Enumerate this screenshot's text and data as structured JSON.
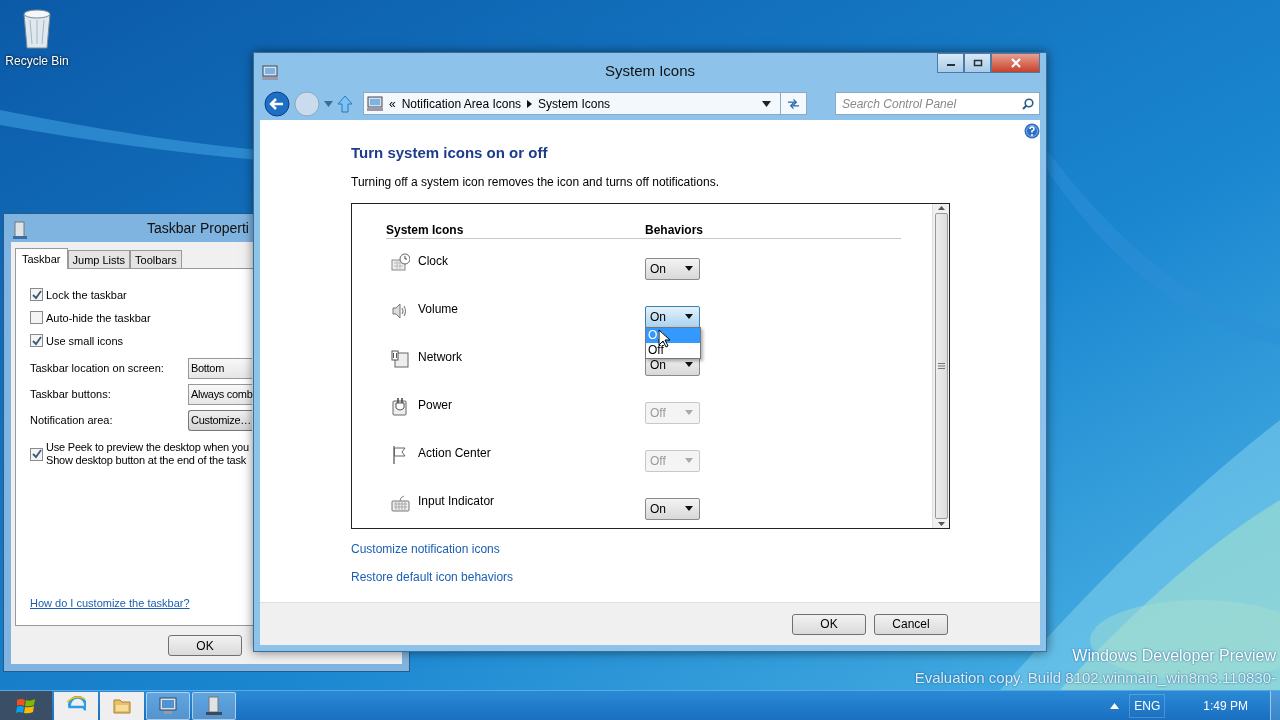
{
  "desktop": {
    "icons": [
      {
        "label": "Recycle Bin"
      }
    ],
    "watermark": [
      "Windows Developer Preview",
      "Evaluation copy. Build 8102.winmain_win8m3.110830-"
    ]
  },
  "taskbar_properties": {
    "title": "Taskbar Properti",
    "tabs": [
      {
        "label": "Taskbar",
        "selected": true
      },
      {
        "label": "Jump Lists",
        "selected": false
      },
      {
        "label": "Toolbars",
        "selected": false
      }
    ],
    "checkboxes": [
      {
        "label": "Lock the taskbar",
        "checked": true
      },
      {
        "label": "Auto-hide the taskbar",
        "checked": false
      },
      {
        "label": "Use small icons",
        "checked": true
      }
    ],
    "settings": [
      {
        "label": "Taskbar location on screen:",
        "value": "Bottom",
        "kind": "dropdown"
      },
      {
        "label": "Taskbar buttons:",
        "value": "Always comb",
        "kind": "dropdown"
      },
      {
        "label": "Notification area:",
        "value": "Customize…",
        "kind": "button"
      }
    ],
    "peek": {
      "lines": [
        "Use Peek to preview the desktop when you",
        "Show desktop button at the end of the task"
      ],
      "checked": true
    },
    "help_link": "How do I customize the taskbar?",
    "buttons": [
      "OK"
    ]
  },
  "system_icons_window": {
    "title": "System Icons",
    "overflow": "«",
    "breadcrumb": [
      "Notification Area Icons",
      "System Icons"
    ],
    "search": {
      "placeholder": "Search Control Panel"
    },
    "heading": "Turn system icons on or off",
    "description": "Turning off a system icon removes the icon and turns off notifications.",
    "columns": [
      "System Icons",
      "Behaviors"
    ],
    "rows": [
      {
        "name": "Clock",
        "behavior": "On",
        "disabled": false,
        "focused": false
      },
      {
        "name": "Volume",
        "behavior": "On",
        "disabled": false,
        "focused": true,
        "options": [
          {
            "label": "On",
            "selected": true
          },
          {
            "label": "Off",
            "selected": false
          }
        ]
      },
      {
        "name": "Network",
        "behavior": "On",
        "disabled": false,
        "focused": false
      },
      {
        "name": "Power",
        "behavior": "Off",
        "disabled": true,
        "focused": false
      },
      {
        "name": "Action Center",
        "behavior": "Off",
        "disabled": true,
        "focused": false
      },
      {
        "name": "Input Indicator",
        "behavior": "On",
        "disabled": false,
        "focused": false
      }
    ],
    "links": [
      "Customize notification icons",
      "Restore default icon behaviors"
    ],
    "buttons": [
      "OK",
      "Cancel"
    ]
  },
  "taskbar": {
    "apps": [
      {
        "active": false
      },
      {
        "active": false
      },
      {
        "active": true
      },
      {
        "active": true
      }
    ],
    "language": "ENG",
    "time": "1:49 PM"
  }
}
